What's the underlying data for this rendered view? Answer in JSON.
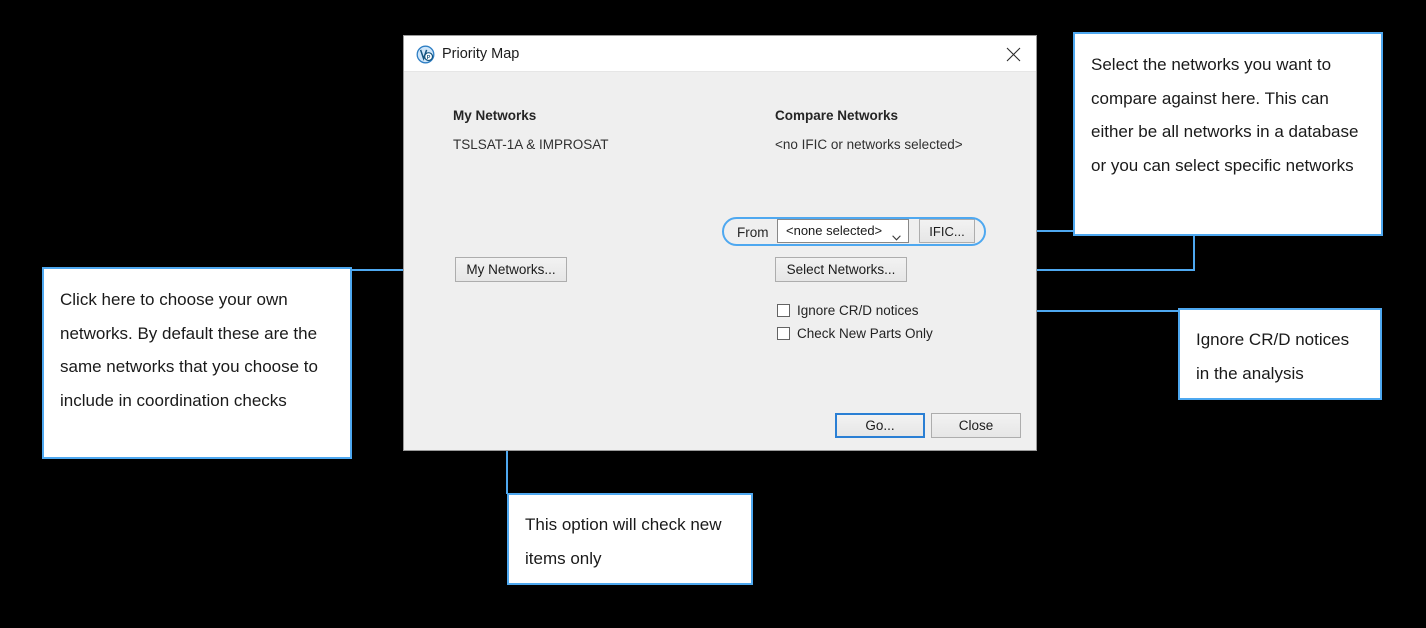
{
  "window": {
    "title": "Priority Map",
    "app_icon": "vp-logo-icon",
    "close_icon": "close-icon"
  },
  "dialog": {
    "my_networks_header": "My Networks",
    "my_networks_value": "TSLSAT-1A & IMPROSAT",
    "compare_networks_header": "Compare Networks",
    "compare_networks_value": "<no IFIC or networks selected>",
    "from_label": "From",
    "from_combo_value": "<none selected>",
    "from_combo_icon": "chevron-down-icon",
    "ific_button": "IFIC...",
    "my_networks_button": "My Networks...",
    "select_networks_button": "Select Networks...",
    "checkboxes": [
      {
        "label": "Ignore CR/D notices",
        "checked": false
      },
      {
        "label": "Check New Parts Only",
        "checked": false
      }
    ],
    "go_button": "Go...",
    "close_button": "Close"
  },
  "callouts": {
    "compare": "Select the networks you want to compare against here. This can either be all networks in a database or you can select specific networks",
    "my_networks": "Click here to choose your own networks. By default these are the same networks that you choose to include in coordination checks",
    "ignore_notices": "Ignore CR/D notices in the analysis",
    "new_parts": "This option will check new items only"
  },
  "colors": {
    "accent": "#4ea8f0",
    "dialog_background": "#efefef",
    "titlebar_background": "#ffffff",
    "page_background": "#000000",
    "focus_border": "#2a7fd4"
  }
}
